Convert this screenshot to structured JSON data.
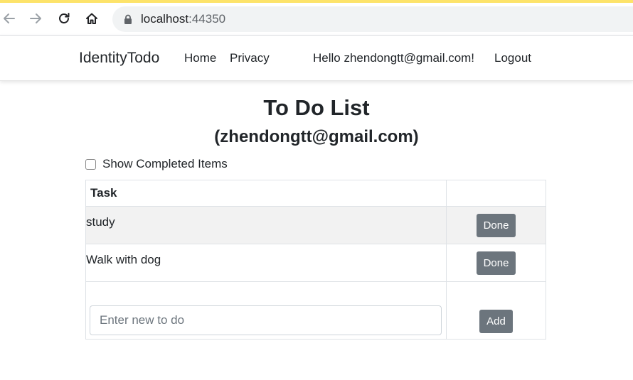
{
  "colors": {
    "accent_strip": "#fde36a",
    "button": "#6c757d"
  },
  "browser": {
    "back_icon": "arrow-left-icon",
    "forward_icon": "arrow-right-icon",
    "reload_icon": "reload-icon",
    "home_icon": "home-icon",
    "lock_icon": "lock-icon",
    "url_host": "localhost",
    "url_port": ":44350"
  },
  "navbar": {
    "brand": "IdentityTodo",
    "links": [
      "Home",
      "Privacy"
    ],
    "greeting": "Hello zhendongtt@gmail.com!",
    "logout": "Logout"
  },
  "page": {
    "title": "To Do List",
    "subtitle": "(zhendongtt@gmail.com)",
    "show_completed_label": "Show Completed Items",
    "show_completed_checked": false
  },
  "table": {
    "header_task": "Task",
    "rows": [
      {
        "task": "study",
        "action": "Done"
      },
      {
        "task": "Walk with dog",
        "action": "Done"
      }
    ],
    "new_todo_placeholder": "Enter new to do",
    "new_todo_value": "",
    "add_label": "Add"
  }
}
